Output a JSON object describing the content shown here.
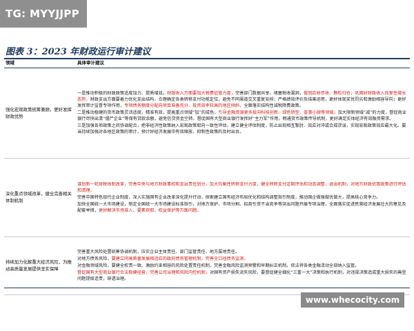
{
  "watermark_top": "TG: MYYJJPP",
  "figure_title": "图表 3：2023 年财政运行审计建议",
  "table": {
    "headers": [
      "领域",
      "具体审计建议"
    ],
    "sections": [
      {
        "field": "强化宏观政策统筹兼顾，更好发挥财政优势",
        "paragraphs": [
          [
            {
              "t": "一是推动积极的财政政策适度加力、提质增效。"
            },
            {
              "t": "财政收入方面要加大税费征管力度，",
              "red": true
            },
            {
              "t": "完善部门数据共享，堵塞税收漏洞，"
            },
            {
              "t": "做到应收尽收、颗粒归仓，巩固好财政收入恢复性增长态势，",
              "red": true
            },
            {
              "t": "财政支出方面要着力优化支出结构，合理确定各类转移支付功能定位，避免不同渠道交叉重复安排；严格绩效评价及结果运用，更好体现奖优罚劣和激励相容导向；更好发挥审计监督专项作用，"
            },
            {
              "t": "专项债务额度分配向项目准备充分、投资效率较高的地区倾斜，",
              "red": true
            },
            {
              "t": "全面落实结构性减税降费政策。"
            }
          ],
          [
            {
              "t": "二是推动稳健的货币政策灵活适度，精准有效，提高重点领域“加”的成色，"
            },
            {
              "t": "引导金融资源更多投向科技创新、绿色转型、普惠小微等领域。",
              "red": true
            },
            {
              "t": "加大限制领域“减”的力度，督促商业银行尽快出清“僵尸企业”等保有贷款余额，避免信贷资金空转。督促国有大型商业银行发挥好“主力军”作用，畅通货币政策传导机制，更好满足实体经济有效融资需求。"
            }
          ],
          [
            {
              "t": "三是加强各项政策之间协调配合，把非经济性政策纳入宏观政策取向一致性评估，建立健全评估制度，防止出现相互掣肘、效应对冲或合成谬误，实现宏观政策效应最大化。要当持续加强对各地区政策的审计，预计好经济发展中有效缩放、抑制性政策的及时出台。"
            }
          ]
        ]
      },
      {
        "field": "深化重点领域改革，健全完善相关体制机制",
        "paragraphs": [
          [
            {
              "t": "谋划新一轮财税体制改革，",
              "red": true
            },
            {
              "t": "完善中央与地方财政事权和支出责任划分，加大均衡性转移支付力度，健全转移支付定期评估和动态调整、退出机制，对地方财政优惠政策进行评估和清理。",
              "red": true
            }
          ],
          [
            {
              "t": "完善中国特色现代企业制度，深入实施国有企业改革深化提升行动，探索建立国有经济布局优化和结构调整指引制度，推动国企做强做优做大，提高核心竞争力。"
            }
          ],
          [
            {
              "t": "加快全国统一大市场建设，制定全国统一大市场建设标准指引，对地方保护、市场分割、招商引资不当竞争等突出问题开展专项治理，全面落实促进民营经济发展壮大的意见及配套举措，"
            },
            {
              "t": "更好解决市场准入、要素获取、权益保护等方面问题。",
              "red": true
            }
          ]
        ]
      },
      {
        "field": "持续加力化解重大经济风险，为推动高质量发展提供坚实保障",
        "paragraphs": [
          [
            {
              "t": "完善重大风险处置统筹协调机制，压实企业主体责任、部门监管责任、地方属地责任。"
            }
          ],
          [
            {
              "t": "对地方债务风险，"
            },
            {
              "t": "要建立同高质量发展相适应的政府债务管理机制，完善全口径债务监测，",
              "red": true
            }
          ],
          [
            {
              "t": "对金融领域风险，要健全权责一致、激励约束相容的风险处置责任机制，完善金融风险监测预警和早期纠正机制，依法将各类金融活动全部纳入监管。"
            }
          ],
          [
            {
              "t": "督促国有大型商业银行合法稳健经营，",
              "red": true
            },
            {
              "t": "完善公司治理和风险内控机制，",
              "red": true
            },
            {
              "t": "对国有资产损失流失风险，要督促健全细化“三重一大”决策和执行机制，对违规决策造成重大损失的典型问题提级追责，穿透治理。"
            }
          ]
        ]
      }
    ]
  },
  "watermark_bottom": "www.whecocity.com"
}
